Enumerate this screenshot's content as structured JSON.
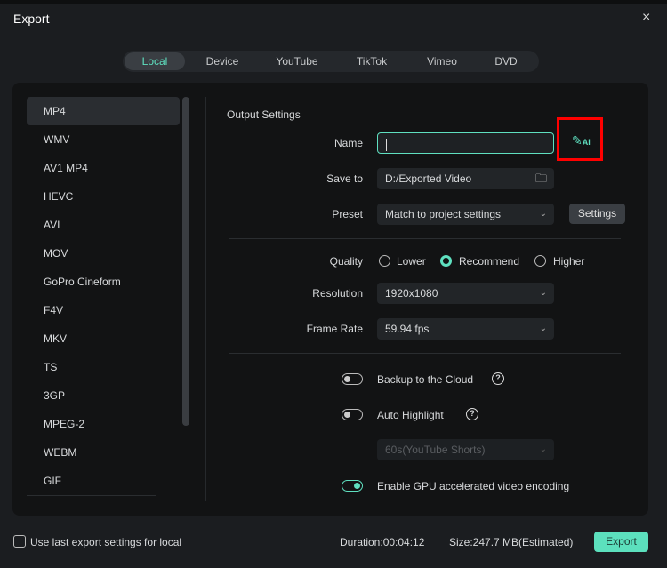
{
  "window": {
    "title": "Export",
    "close_icon": "×"
  },
  "tabs": [
    "Local",
    "Device",
    "YouTube",
    "TikTok",
    "Vimeo",
    "DVD"
  ],
  "formats": [
    "MP4",
    "WMV",
    "AV1 MP4",
    "HEVC",
    "AVI",
    "MOV",
    "GoPro Cineform",
    "F4V",
    "MKV",
    "TS",
    "3GP",
    "MPEG-2",
    "WEBM",
    "GIF"
  ],
  "selected_format": "MP4",
  "settings": {
    "section_title": "Output Settings",
    "name_label": "Name",
    "name_value": "",
    "ai_label": "AI",
    "save_label": "Save to",
    "save_value": "D:/Exported Video",
    "preset_label": "Preset",
    "preset_value": "Match to project settings",
    "settings_button": "Settings",
    "quality_label": "Quality",
    "quality_options": [
      "Lower",
      "Recommend",
      "Higher"
    ],
    "quality_selected": "Recommend",
    "resolution_label": "Resolution",
    "resolution_value": "1920x1080",
    "framerate_label": "Frame Rate",
    "framerate_value": "59.94 fps",
    "backup_label": "Backup to the Cloud",
    "backup_on": false,
    "highlight_label": "Auto Highlight",
    "highlight_on": false,
    "highlight_duration": "60s(YouTube Shorts)",
    "gpu_label": "Enable GPU accelerated video encoding",
    "gpu_on": true
  },
  "footer": {
    "use_last": "Use last export settings for local",
    "duration": "Duration:00:04:12",
    "size": "Size:247.7 MB(Estimated)",
    "export_button": "Export"
  },
  "colors": {
    "accent": "#5fe0c0",
    "highlight_box": "#ff0000"
  }
}
